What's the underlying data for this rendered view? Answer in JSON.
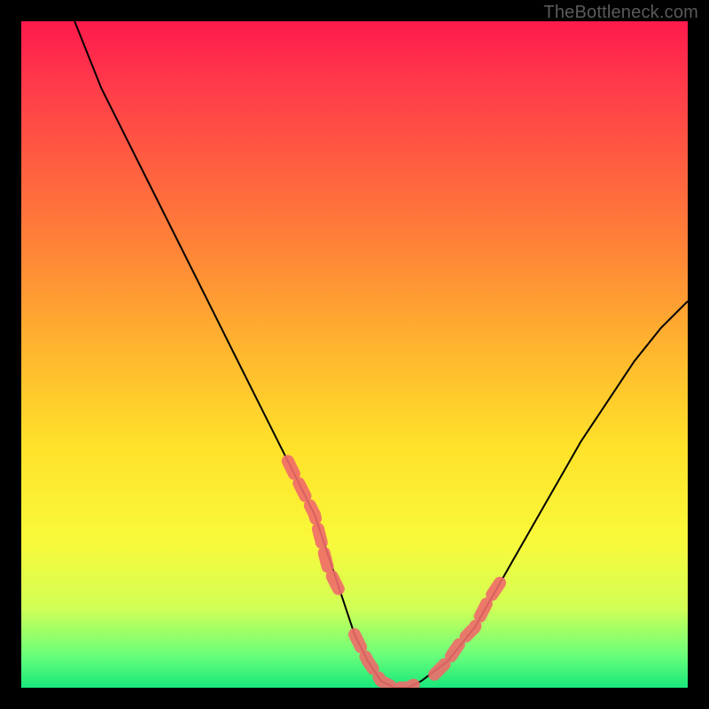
{
  "watermark": "TheBottleneck.com",
  "chart_data": {
    "type": "line",
    "title": "",
    "xlabel": "",
    "ylabel": "",
    "xlim": [
      0,
      100
    ],
    "ylim": [
      0,
      100
    ],
    "grid": false,
    "series": [
      {
        "name": "curve",
        "x": [
          8,
          12,
          16,
          20,
          24,
          28,
          32,
          36,
          40,
          44,
          48,
          50,
          52,
          54,
          56,
          58,
          60,
          64,
          68,
          72,
          76,
          80,
          84,
          88,
          92,
          96,
          100
        ],
        "y": [
          100,
          90,
          82,
          74,
          66,
          58,
          50,
          42,
          34,
          26,
          14,
          8,
          4,
          1,
          0,
          0,
          1,
          4,
          9,
          16,
          23,
          30,
          37,
          43,
          49,
          54,
          58
        ]
      },
      {
        "name": "highlight-left",
        "x": [
          40,
          41,
          42,
          43,
          44,
          45,
          46,
          47,
          48
        ],
        "y": [
          34,
          32,
          30,
          28,
          26,
          22,
          18,
          16,
          14
        ]
      },
      {
        "name": "highlight-bottom",
        "x": [
          50,
          51,
          52,
          54,
          56,
          58,
          60
        ],
        "y": [
          8,
          6,
          4,
          1,
          0,
          0,
          1
        ]
      },
      {
        "name": "highlight-right",
        "x": [
          62,
          64,
          66,
          68,
          70,
          72
        ],
        "y": [
          2,
          4,
          7,
          9,
          13,
          16
        ]
      }
    ],
    "colors": {
      "curve": "#000000",
      "highlight": "#f06a6a"
    }
  }
}
